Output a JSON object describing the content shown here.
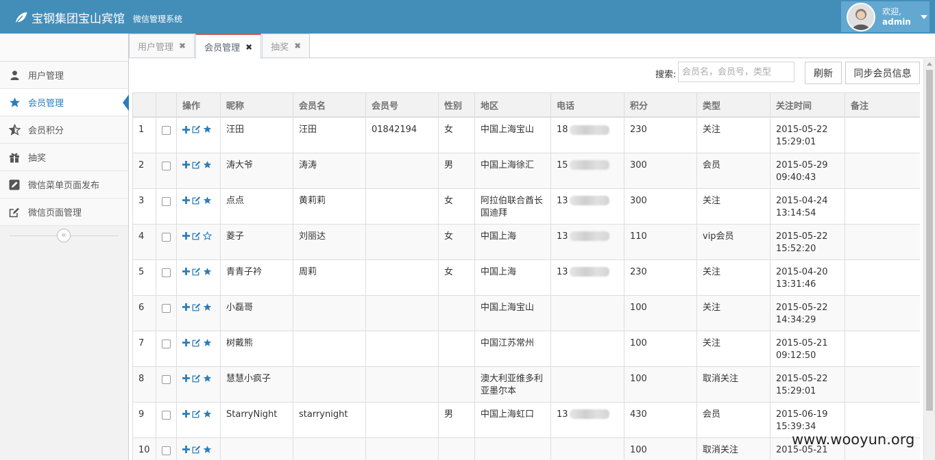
{
  "header": {
    "brand_title": "宝钢集团宝山宾馆",
    "brand_subtitle": "微信管理系统",
    "welcome": "欢迎,",
    "username": "admin"
  },
  "sidebar": {
    "items": [
      {
        "label": "用户管理",
        "icon": "user-icon"
      },
      {
        "label": "会员管理",
        "icon": "star-icon"
      },
      {
        "label": "会员积分",
        "icon": "star-half-icon"
      },
      {
        "label": "抽奖",
        "icon": "gift-icon"
      },
      {
        "label": "微信菜单页面发布",
        "icon": "pencil-square-icon"
      },
      {
        "label": "微信页面管理",
        "icon": "edit-icon"
      }
    ]
  },
  "tabs": [
    {
      "label": "用户管理"
    },
    {
      "label": "会员管理"
    },
    {
      "label": "抽奖"
    }
  ],
  "toolbar": {
    "search_label": "搜索:",
    "search_placeholder": "会员名，会员号，类型",
    "refresh_label": "刷新",
    "sync_label": "同步会员信息"
  },
  "table": {
    "headers": [
      "",
      "",
      "操作",
      "昵称",
      "会员名",
      "会员号",
      "性别",
      "地区",
      "电话",
      "积分",
      "类型",
      "关注时间",
      "备注"
    ],
    "rows": [
      {
        "no": "1",
        "nickname": "汪田",
        "name": "汪田",
        "member_no": "01842194",
        "gender": "女",
        "region": "中国上海宝山",
        "phone": "18",
        "points": "230",
        "type": "关注",
        "date": "2015-05-22",
        "time": "15:29:01",
        "remark": "",
        "star": "filled"
      },
      {
        "no": "2",
        "nickname": "涛大爷",
        "name": "涛涛",
        "member_no": "",
        "gender": "男",
        "region": "中国上海徐汇",
        "phone": "15",
        "points": "300",
        "type": "会员",
        "date": "2015-05-29",
        "time": "09:40:43",
        "remark": "",
        "star": "filled"
      },
      {
        "no": "3",
        "nickname": "点点",
        "name": "黄莉莉",
        "member_no": "",
        "gender": "女",
        "region": "阿拉伯联合酋长国迪拜",
        "phone": "13",
        "points": "300",
        "type": "关注",
        "date": "2015-04-24",
        "time": "13:14:54",
        "remark": "",
        "star": "filled"
      },
      {
        "no": "4",
        "nickname": "菱子",
        "name": "刘丽达",
        "member_no": "",
        "gender": "女",
        "region": "中国上海",
        "phone": "13",
        "points": "110",
        "type": "vip会员",
        "date": "2015-05-22",
        "time": "15:52:20",
        "remark": "",
        "star": "empty"
      },
      {
        "no": "5",
        "nickname": "青青子衿",
        "name": "周莉",
        "member_no": "",
        "gender": "女",
        "region": "中国上海",
        "phone": "13",
        "points": "230",
        "type": "关注",
        "date": "2015-04-20",
        "time": "13:31:46",
        "remark": "",
        "star": "filled"
      },
      {
        "no": "6",
        "nickname": "小磊哥",
        "name": "",
        "member_no": "",
        "gender": "",
        "region": "中国上海宝山",
        "phone": "",
        "points": "100",
        "type": "关注",
        "date": "2015-05-22",
        "time": "14:34:29",
        "remark": "",
        "star": "filled"
      },
      {
        "no": "7",
        "nickname": "树戴熊",
        "name": "",
        "member_no": "",
        "gender": "",
        "region": "中国江苏常州",
        "phone": "",
        "points": "100",
        "type": "关注",
        "date": "2015-05-21",
        "time": "09:12:50",
        "remark": "",
        "star": "filled"
      },
      {
        "no": "8",
        "nickname": "慧慧小疯子",
        "name": "",
        "member_no": "",
        "gender": "",
        "region": "澳大利亚维多利亚墨尔本",
        "phone": "",
        "points": "100",
        "type": "取消关注",
        "date": "2015-05-22",
        "time": "15:29:01",
        "remark": "",
        "star": "filled"
      },
      {
        "no": "9",
        "nickname": "StarryNight",
        "name": "starrynight",
        "member_no": "",
        "gender": "男",
        "region": "中国上海虹口",
        "phone": "13",
        "points": "430",
        "type": "会员",
        "date": "2015-06-19",
        "time": "15:39:34",
        "remark": "",
        "star": "filled"
      },
      {
        "no": "10",
        "nickname": "",
        "name": "",
        "member_no": "",
        "gender": "",
        "region": "",
        "phone": "",
        "points": "100",
        "type": "取消关注",
        "date": "2015-05-21",
        "time": "",
        "remark": "",
        "star": "filled"
      }
    ]
  },
  "watermark": "www.wooyun.org",
  "colors": {
    "header_bg": "#438eb9",
    "user_box_bg": "#62a8d1",
    "accent": "#2b7dbc",
    "active_tab_top": "#cc5555"
  }
}
